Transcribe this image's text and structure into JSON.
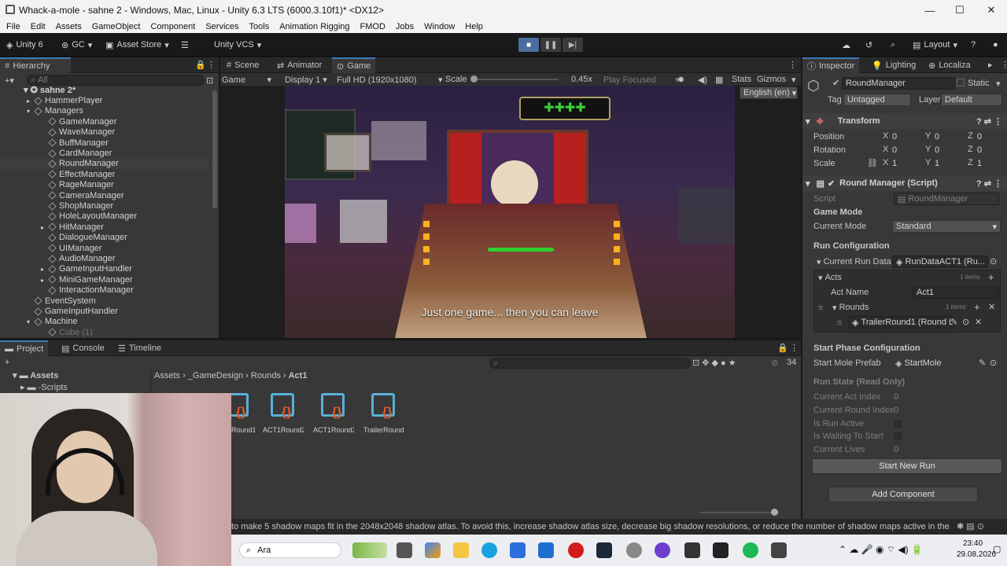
{
  "window": {
    "title": "Whack-a-mole - sahne 2 - Windows, Mac, Linux - Unity 6.3 LTS (6000.3.10f1)* <DX12>",
    "min": "—",
    "max": "☐",
    "close": "✕"
  },
  "menu": [
    "File",
    "Edit",
    "Assets",
    "GameObject",
    "Component",
    "Services",
    "Tools",
    "Animation Rigging",
    "FMOD",
    "Jobs",
    "Window",
    "Help"
  ],
  "toolbar": {
    "unity": "Unity 6",
    "gc": "GC",
    "asset_store": "Asset Store",
    "vcs": "Unity VCS",
    "layout": "Layout"
  },
  "hierarchy": {
    "tab": "Hierarchy",
    "search": "All",
    "scene": "sahne 2*",
    "items": [
      "HammerPlayer",
      "Managers",
      "GameManager",
      "WaveManager",
      "BuffManager",
      "CardManager",
      "RoundManager",
      "EffectManager",
      "RageManager",
      "CameraManager",
      "ShopManager",
      "HoleLayoutManager",
      "HitManager",
      "DialogueManager",
      "UIManager",
      "AudioManager",
      "GameInputHandler",
      "MiniGameManager",
      "InteractionManager",
      "EventSystem",
      "GameInputHandler",
      "Machine",
      "Cube (1)"
    ]
  },
  "center_tabs": [
    "Scene",
    "Animator",
    "Game"
  ],
  "game_bar": {
    "mode": "Game",
    "display": "Display 1",
    "resolution": "Full HD (1920x1080)",
    "scale_label": "Scale",
    "scale_value": "0.45x",
    "play_focused": "Play Focused",
    "stats": "Stats",
    "gizmos": "Gizmos",
    "language": "English (en)"
  },
  "game_view": {
    "subtitle": "Just one game... then you can leave"
  },
  "project": {
    "tabs": [
      "Project",
      "Console",
      "Timeline"
    ],
    "tree": [
      "Assets",
      "-Scripts"
    ],
    "breadcrumb": [
      "Assets",
      "_GameDesign",
      "Rounds",
      "Act1"
    ],
    "count": "34",
    "assets": [
      "ACT1Round1",
      "ACT1Round2",
      "ACT1Round3",
      "TrailerRound1"
    ],
    "asset_visible": [
      "Round1",
      "ACT1Round2",
      "ACT1Round3",
      "TrailerRound1"
    ]
  },
  "console_msg": "to make 5 shadow maps fit in the 2048x2048 shadow atlas. To avoid this, increase shadow atlas size, decrease big shadow resolutions, or reduce the number of shadow maps active in the",
  "inspector": {
    "tabs": [
      "Inspector",
      "Lighting",
      "Localiza"
    ],
    "object_name": "RoundManager",
    "static": "Static",
    "tag_label": "Tag",
    "tag": "Untagged",
    "layer_label": "Layer",
    "layer": "Default",
    "transform": {
      "title": "Transform",
      "rows": [
        {
          "label": "Position",
          "x": "0",
          "y": "0",
          "z": "0"
        },
        {
          "label": "Rotation",
          "x": "0",
          "y": "0",
          "z": "0"
        },
        {
          "label": "Scale",
          "x": "1",
          "y": "1",
          "z": "1"
        }
      ]
    },
    "script": {
      "title": "Round Manager (Script)",
      "script_label": "Script",
      "script_value": "RoundManager",
      "game_mode": "Game Mode",
      "current_mode_label": "Current Mode",
      "current_mode": "Standard",
      "run_config": "Run Configuration",
      "run_data_label": "Current Run Data",
      "run_data": "RunDataACT1 (Ru...",
      "acts": "Acts",
      "acts_count": "1 items",
      "act_name_label": "Act Name",
      "act_name": "Act1",
      "rounds": "Rounds",
      "rounds_count": "1 items",
      "round_item": "TrailerRound1 (Round L...",
      "start_phase": "Start Phase Configuration",
      "start_mole_label": "Start Mole Prefab",
      "start_mole": "StartMole",
      "run_state": "Run State (Read Only)",
      "state_rows": [
        {
          "label": "Current Act Index",
          "value": "0"
        },
        {
          "label": "Current Round Index",
          "value": "0"
        },
        {
          "label": "Is Run Active",
          "value": ""
        },
        {
          "label": "Is Waiting To Start",
          "value": ""
        },
        {
          "label": "Current Lives",
          "value": "0"
        }
      ],
      "start_new_run": "Start New Run"
    },
    "add_component": "Add Component"
  },
  "taskbar": {
    "search": "Ara",
    "time": "23:40",
    "date": "29.08.2026"
  },
  "colors": {
    "accent": "#3a79bb",
    "panel": "#383838",
    "titlebar": "#f3f3f3"
  }
}
